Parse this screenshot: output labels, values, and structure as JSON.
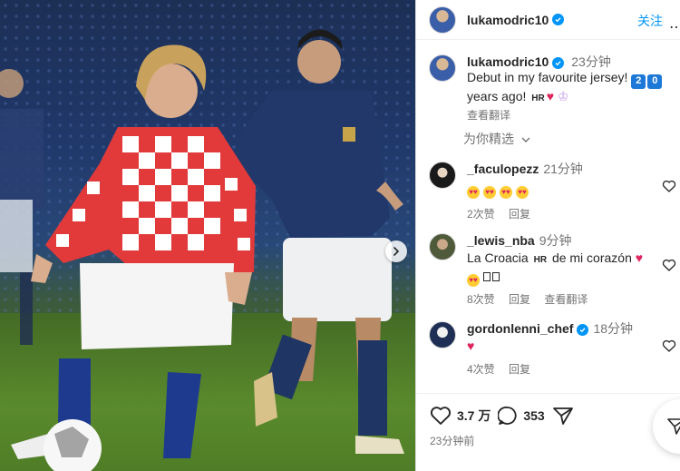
{
  "post": {
    "username": "lukamodric10",
    "follow_label": "关注",
    "more_icon": "more-horizontal-icon"
  },
  "caption": {
    "username": "lukamodric10",
    "time": "23分钟",
    "text_line1": "Debut in my favourite jersey!",
    "tag1": "2",
    "tag2": "0",
    "text_line2": "years ago!",
    "flag": "HR",
    "translate": "查看翻译"
  },
  "for_you": "为你精选",
  "comments": [
    {
      "username": "_faculopezz",
      "time": "21分钟",
      "likes": "2次赞",
      "reply": "回复"
    },
    {
      "username": "_lewis_nba",
      "time": "9分钟",
      "text_a": "La Croacia",
      "flag": "HR",
      "text_b": "de mi corazón",
      "likes": "8次赞",
      "reply": "回复",
      "translate": "查看翻译"
    },
    {
      "username": "gordonlenni_chef",
      "time": "18分钟",
      "likes": "4次赞",
      "reply": "回复"
    }
  ],
  "footer": {
    "like_count": "3.7 万",
    "comment_count": "353",
    "ago": "23分钟前"
  },
  "colors": {
    "accent": "#0095f6",
    "heart": "#e0245e",
    "muted": "#737373"
  }
}
